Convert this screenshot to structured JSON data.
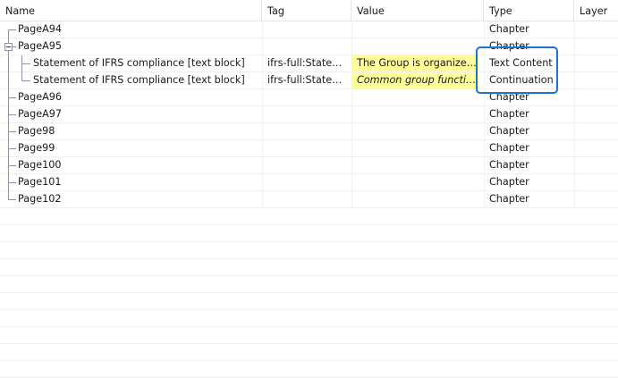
{
  "columns": {
    "name": "Name",
    "tag": "Tag",
    "value": "Value",
    "type": "Type",
    "layer": "Layer"
  },
  "rows": [
    {
      "name": "PageA94",
      "tag": "",
      "value": "",
      "type": "Chapter"
    },
    {
      "name": "PageA95",
      "tag": "",
      "value": "",
      "type": "Chapter"
    },
    {
      "name": "Statement of IFRS compliance [text block]",
      "tag": "ifrs-full:Stateme...",
      "value": "The Group is organized i...",
      "type": "Text Content"
    },
    {
      "name": "Statement of IFRS compliance [text block]",
      "tag": "ifrs-full:Stateme...",
      "value": "Common group functions...",
      "type": "Continuation"
    },
    {
      "name": "PageA96",
      "tag": "",
      "value": "",
      "type": "Chapter"
    },
    {
      "name": "PageA97",
      "tag": "",
      "value": "",
      "type": "Chapter"
    },
    {
      "name": "Page98",
      "tag": "",
      "value": "",
      "type": "Chapter"
    },
    {
      "name": "Page99",
      "tag": "",
      "value": "",
      "type": "Chapter"
    },
    {
      "name": "Page100",
      "tag": "",
      "value": "",
      "type": "Chapter"
    },
    {
      "name": "Page101",
      "tag": "",
      "value": "",
      "type": "Chapter"
    },
    {
      "name": "Page102",
      "tag": "",
      "value": "",
      "type": "Chapter"
    }
  ],
  "colors": {
    "highlight_border": "#1e73d8",
    "value_highlight": "#ffff99",
    "tree_lines": "#8f8fb5"
  }
}
